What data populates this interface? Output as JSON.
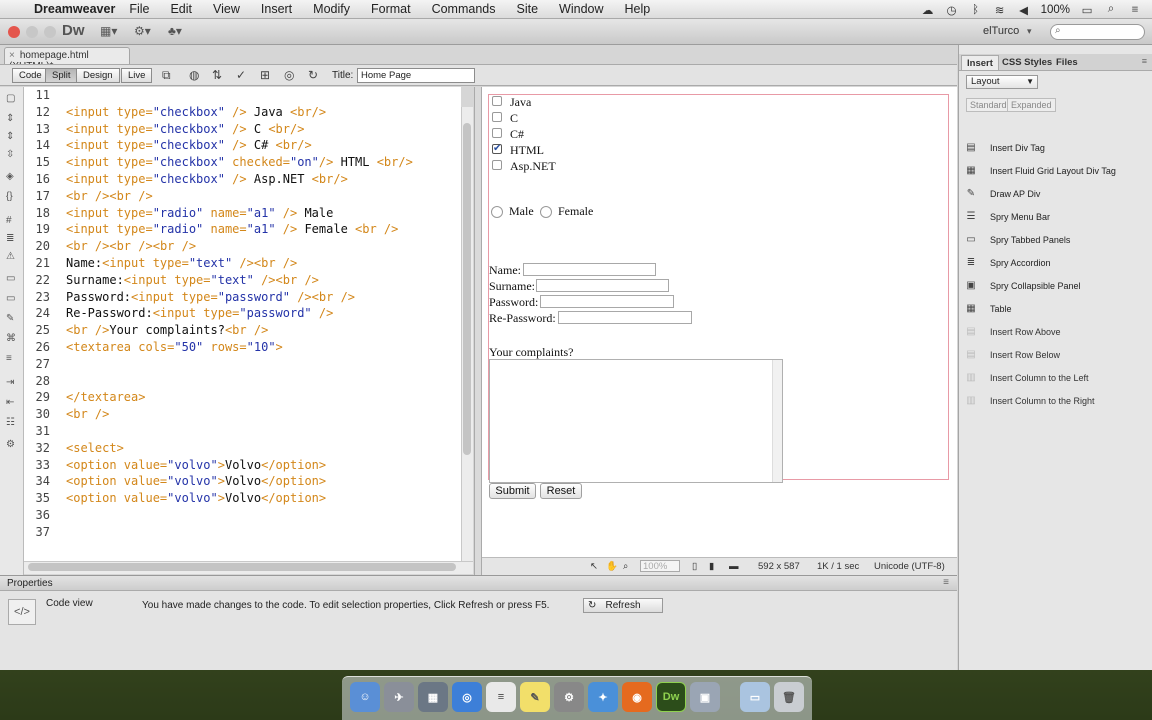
{
  "menubar": {
    "app_name": "Dreamweaver",
    "items": [
      "File",
      "Edit",
      "View",
      "Insert",
      "Modify",
      "Format",
      "Commands",
      "Site",
      "Window",
      "Help"
    ],
    "battery": "100%"
  },
  "appbar": {
    "logo": "Dw",
    "user": "elTurco"
  },
  "document": {
    "tab_label": "homepage.html (XHTML)*",
    "views": [
      "Code",
      "Split",
      "Design",
      "Live"
    ],
    "active_view": "Split",
    "title_label": "Title:",
    "title_value": "Home Page"
  },
  "code_lines": [
    {
      "n": "11",
      "t": ""
    },
    {
      "n": "12",
      "t": "<input type=\"checkbox\" /> Java <br/>"
    },
    {
      "n": "13",
      "t": "<input type=\"checkbox\" /> C <br/>"
    },
    {
      "n": "14",
      "t": "<input type=\"checkbox\" /> C# <br/>"
    },
    {
      "n": "15",
      "t": "<input type=\"checkbox\" checked=\"on\"/> HTML <br/>"
    },
    {
      "n": "16",
      "t": "<input type=\"checkbox\" /> Asp.NET <br/>"
    },
    {
      "n": "17",
      "t": "<br /><br />"
    },
    {
      "n": "18",
      "t": "<input type=\"radio\" name=\"a1\" /> Male"
    },
    {
      "n": "19",
      "t": "<input type=\"radio\" name=\"a1\" /> Female <br />"
    },
    {
      "n": "20",
      "t": "<br /><br /><br />"
    },
    {
      "n": "21",
      "t": "Name:<input type=\"text\" /><br />"
    },
    {
      "n": "22",
      "t": "Surname:<input type=\"text\" /><br />"
    },
    {
      "n": "23",
      "t": "Password:<input type=\"password\" /><br />"
    },
    {
      "n": "24",
      "t": "Re-Password:<input type=\"password\" />"
    },
    {
      "n": "25",
      "t": "<br />Your complaints?<br />"
    },
    {
      "n": "26",
      "t": "<textarea cols=\"50\" rows=\"10\">"
    },
    {
      "n": "27",
      "t": ""
    },
    {
      "n": "28",
      "t": ""
    },
    {
      "n": "29",
      "t": "</textarea>"
    },
    {
      "n": "30",
      "t": "<br />"
    },
    {
      "n": "31",
      "t": ""
    },
    {
      "n": "32",
      "t": "<select>"
    },
    {
      "n": "33",
      "t": "<option value=\"volvo\">Volvo</option>"
    },
    {
      "n": "34",
      "t": "<option value=\"volvo\">Volvo</option>"
    },
    {
      "n": "35",
      "t": "<option value=\"volvo\">Volvo</option>"
    },
    {
      "n": "36",
      "t": ""
    },
    {
      "n": "37",
      "t": ""
    }
  ],
  "design": {
    "checkboxes": [
      {
        "label": "Java",
        "checked": false
      },
      {
        "label": "C",
        "checked": false
      },
      {
        "label": "C#",
        "checked": false
      },
      {
        "label": "HTML",
        "checked": true
      },
      {
        "label": "Asp.NET",
        "checked": false
      }
    ],
    "radios": [
      "Male",
      "Female"
    ],
    "fields": [
      "Name:",
      "Surname:",
      "Password:",
      "Re-Password:"
    ],
    "complaints_label": "Your complaints?",
    "submit": "Submit",
    "reset": "Reset"
  },
  "status": {
    "zoom": "100%",
    "size": "592 x 587",
    "download": "1K / 1 sec",
    "encoding": "Unicode (UTF-8)"
  },
  "properties": {
    "header": "Properties",
    "code_view": "Code view",
    "message": "You have made changes to the code. To edit selection properties, Click Refresh or press F5.",
    "refresh": "Refresh"
  },
  "insert_panel": {
    "tabs": [
      "Insert",
      "CSS Styles",
      "Files"
    ],
    "category": "Layout",
    "modes": [
      "Standard",
      "Expanded"
    ],
    "items": [
      "Insert Div Tag",
      "Insert Fluid Grid Layout Div Tag",
      "Draw AP Div",
      "Spry Menu Bar",
      "Spry Tabbed Panels",
      "Spry Accordion",
      "Spry Collapsible Panel",
      "Table",
      "Insert Row Above",
      "Insert Row Below",
      "Insert Column to the Left",
      "Insert Column to the Right"
    ]
  },
  "colors": {
    "tag": "#d3871a",
    "value": "#2433a8",
    "design_border": "#e89aa6"
  }
}
